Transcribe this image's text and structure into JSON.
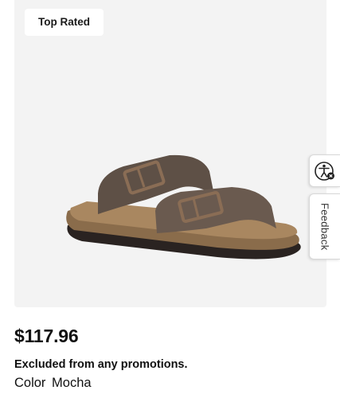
{
  "product": {
    "badge": "Top Rated",
    "image_alt": "Mocha two-strap buckle sandal",
    "price": "$117.96",
    "promo_note": "Excluded from any promotions.",
    "color_label": "Color",
    "color_value": "Mocha"
  },
  "side_tabs": {
    "accessibility_icon": "accessibility-icon",
    "feedback_label": "Feedback"
  },
  "colors": {
    "image_background": "#f3f3f3",
    "strap": "#5e5046",
    "footbed": "#a07d55",
    "sole": "#2a2321",
    "buckle": "#8a6d55"
  }
}
